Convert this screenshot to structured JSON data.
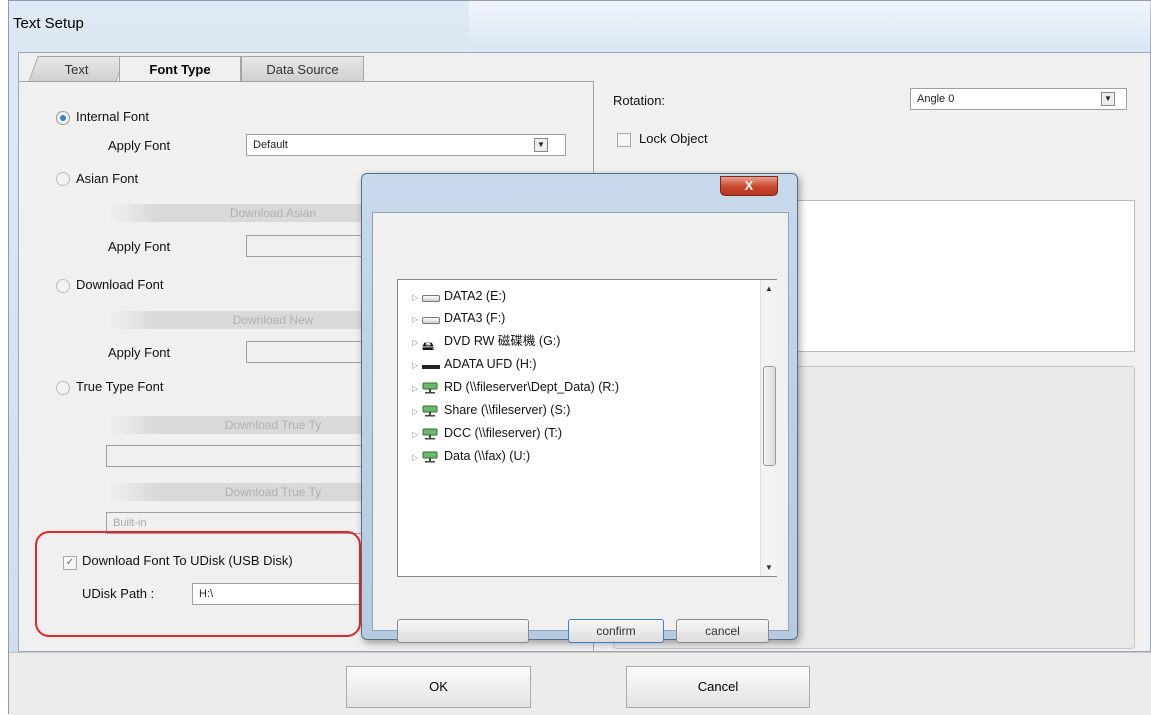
{
  "window": {
    "title": "Text Setup"
  },
  "tabs": [
    {
      "label": "Text"
    },
    {
      "label": "Font Type"
    },
    {
      "label": "Data Source"
    }
  ],
  "font_type": {
    "internal_font_label": "Internal Font",
    "apply_font_label": "Apply Font",
    "internal_apply_value": "Default",
    "asian_font_label": "Asian Font",
    "asian_download_label": "Download Asian",
    "download_font_label": "Download Font",
    "download_new_label": "Download New",
    "true_type_label": "True Type Font",
    "download_true_type_1": "Download True Ty",
    "download_true_type_2": "Download True Ty",
    "builtin_value": "Built-in",
    "udisk_checkbox_label": "Download Font To UDisk (USB Disk)",
    "udisk_path_label": "UDisk Path :",
    "udisk_path_value": "H:\\"
  },
  "right": {
    "rotation_label": "Rotation:",
    "rotation_value": "Angle 0",
    "lock_object_label": "Lock Object"
  },
  "browse_dialog": {
    "close_label": "X",
    "drives": [
      {
        "label": "DATA2 (E:)",
        "icon": "drive-icon"
      },
      {
        "label": "DATA3 (F:)",
        "icon": "drive-icon"
      },
      {
        "label": "DVD RW 磁碟機 (G:)",
        "icon": "dvd-icon"
      },
      {
        "label": "ADATA UFD (H:)",
        "icon": "usb-drive-icon"
      },
      {
        "label": "RD (\\\\fileserver\\Dept_Data) (R:)",
        "icon": "network-drive-icon"
      },
      {
        "label": "Share (\\\\fileserver) (S:)",
        "icon": "network-drive-icon"
      },
      {
        "label": "DCC (\\\\fileserver) (T:)",
        "icon": "network-drive-icon"
      },
      {
        "label": "Data (\\\\fax) (U:)",
        "icon": "network-drive-icon"
      }
    ],
    "confirm_label": "confirm",
    "cancel_label": "cancel"
  },
  "footer": {
    "ok_label": "OK",
    "cancel_label": "Cancel"
  },
  "colors": {
    "highlight": "#e0262b",
    "dialog_frame": "#bcd0e6",
    "close_button": "#c9462c"
  }
}
